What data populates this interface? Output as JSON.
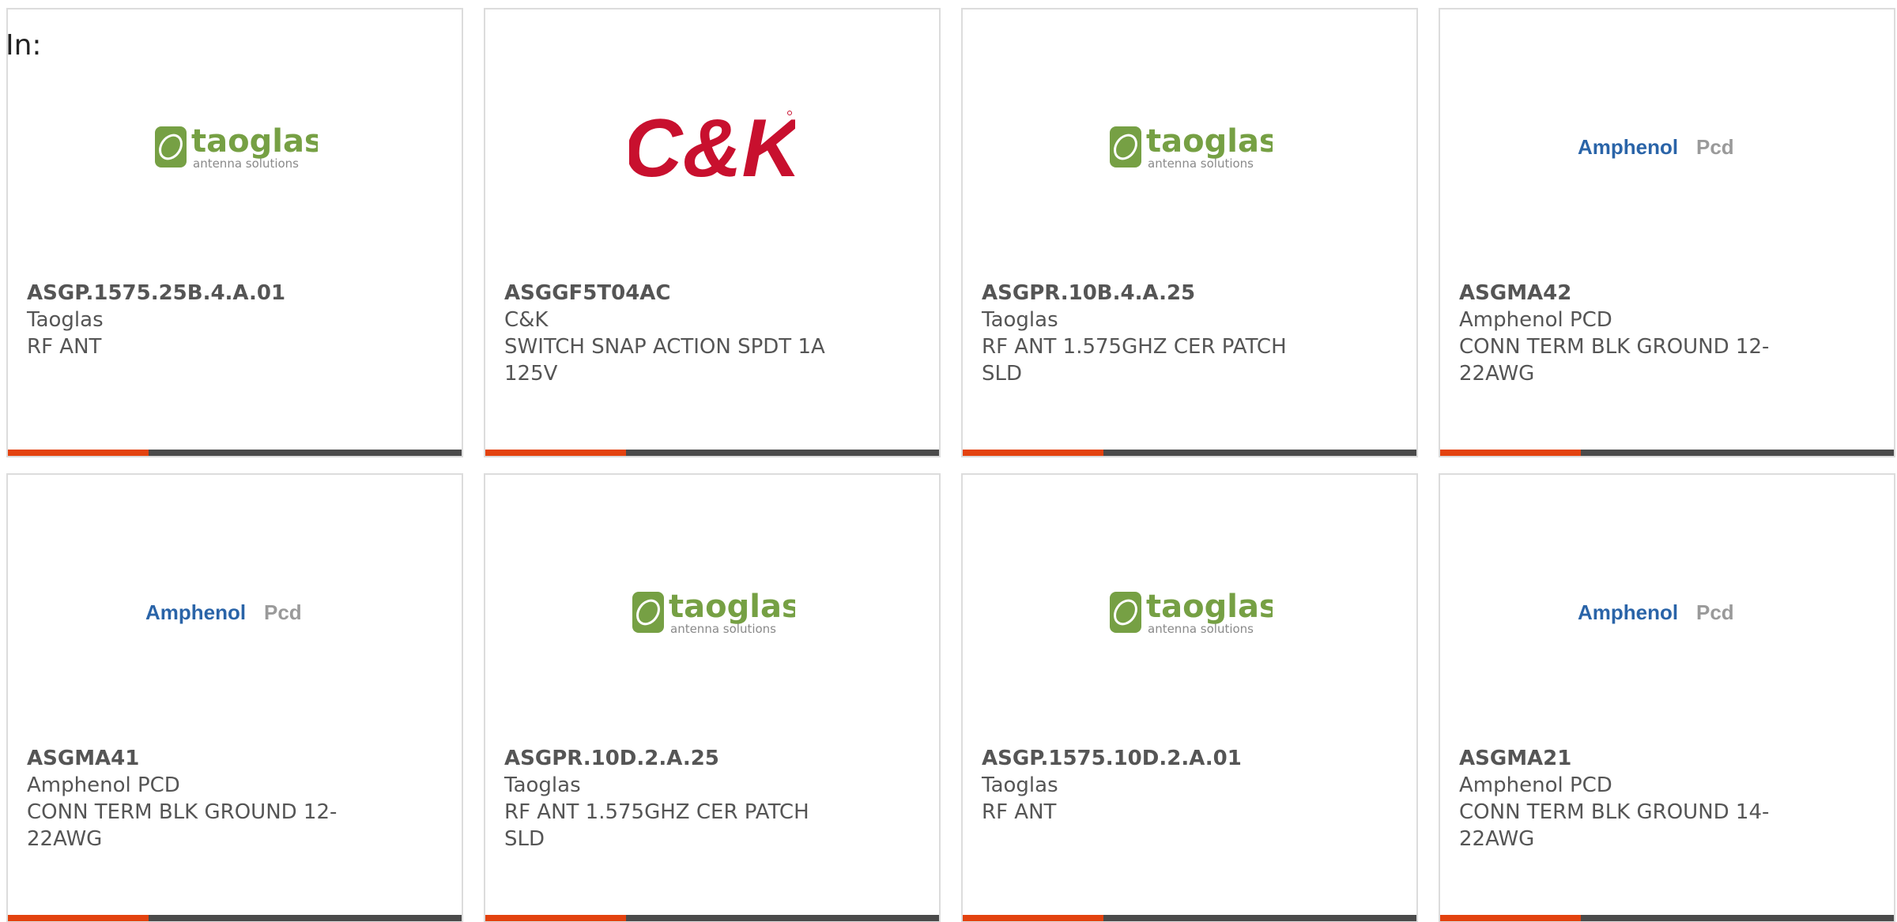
{
  "header": {
    "label": "In:"
  },
  "colors": {
    "accent": "#e3420f",
    "bar_track": "#4a4a4a",
    "taoglas_green": "#76a044",
    "ck_red": "#c8102e",
    "amphenol_blue": "#2a64a8"
  },
  "brands": {
    "taoglas": {
      "name": "taoglas",
      "tagline": "antenna solutions",
      "icon": "taoglas-logo-icon"
    },
    "ck": {
      "name": "C&K",
      "icon": "ck-logo-icon"
    },
    "amphenol": {
      "name": "Amphenol",
      "suffix": "Pcd",
      "icon": "amphenol-pcd-logo-icon"
    }
  },
  "cards": [
    {
      "part_number": "ASGP.1575.25B.4.A.01",
      "manufacturer": "Taoglas",
      "description": "RF ANT",
      "logo": "taoglas",
      "progress": 0.31
    },
    {
      "part_number": "ASGGF5T04AC",
      "manufacturer": "C&K",
      "description": "SWITCH SNAP ACTION SPDT 1A 125V",
      "logo": "ck",
      "progress": 0.31
    },
    {
      "part_number": "ASGPR.10B.4.A.25",
      "manufacturer": "Taoglas",
      "description": "RF ANT 1.575GHZ CER PATCH SLD",
      "logo": "taoglas",
      "progress": 0.31
    },
    {
      "part_number": "ASGMA42",
      "manufacturer": "Amphenol PCD",
      "description": "CONN TERM BLK GROUND 12-22AWG",
      "logo": "amphenol",
      "progress": 0.31
    },
    {
      "part_number": "ASGMA41",
      "manufacturer": "Amphenol PCD",
      "description": "CONN TERM BLK GROUND 12-22AWG",
      "logo": "amphenol",
      "progress": 0.31
    },
    {
      "part_number": "ASGPR.10D.2.A.25",
      "manufacturer": "Taoglas",
      "description": "RF ANT 1.575GHZ CER PATCH SLD",
      "logo": "taoglas",
      "progress": 0.31
    },
    {
      "part_number": "ASGP.1575.10D.2.A.01",
      "manufacturer": "Taoglas",
      "description": "RF ANT",
      "logo": "taoglas",
      "progress": 0.31
    },
    {
      "part_number": "ASGMA21",
      "manufacturer": "Amphenol PCD",
      "description": "CONN TERM BLK GROUND 14-22AWG",
      "logo": "amphenol",
      "progress": 0.31
    }
  ]
}
